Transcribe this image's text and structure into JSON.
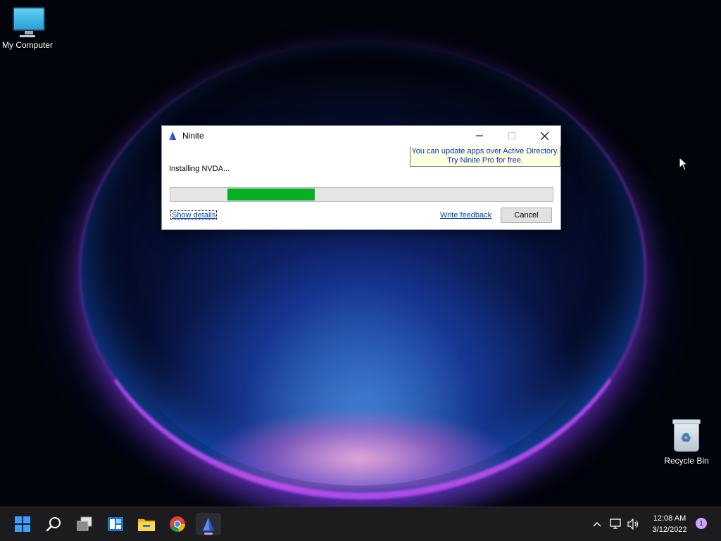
{
  "desktop": {
    "icons": [
      {
        "label": "My Computer",
        "icon": "monitor-icon"
      },
      {
        "label": "Recycle Bin",
        "icon": "recycle-bin-icon"
      }
    ]
  },
  "dialog": {
    "title": "Ninite",
    "promo_line1": "You can update apps over Active Directory.",
    "promo_line2": "Try Ninite Pro for free.",
    "status": "Installing NVDA...",
    "progress": {
      "start": 0.15,
      "end": 0.38,
      "color": "#06b025"
    },
    "show_details_label": "Show details",
    "feedback_label": "Write feedback",
    "cancel_label": "Cancel"
  },
  "taskbar": {
    "apps": [
      "start-icon",
      "search-icon",
      "task-view-icon",
      "widgets-icon",
      "file-explorer-icon",
      "chrome-icon",
      "ninite-icon"
    ],
    "active_app": "ninite-icon",
    "tray_icons": [
      "chevron-up-icon",
      "network-icon",
      "volume-icon"
    ],
    "time": "12:08 AM",
    "date": "3/12/2022",
    "notification_count": "1"
  },
  "colors": {
    "accent": "#bfa1ff",
    "taskbar": "#1c1c1f",
    "link": "#0044aa",
    "promo_bg": "#ffffe1"
  }
}
